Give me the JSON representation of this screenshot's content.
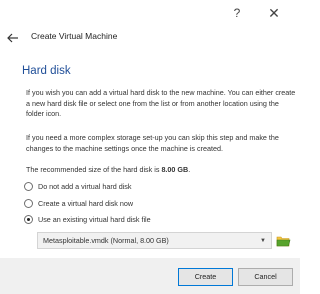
{
  "titlebar": {
    "help_label": "?",
    "close_label": "✕"
  },
  "header": {
    "back_icon": "arrow-left-icon",
    "title": "Create Virtual Machine"
  },
  "page": {
    "heading": "Hard disk",
    "paragraph1": "If you wish you can add a virtual hard disk to the new machine. You can either create a new hard disk file or select one from the list or from another location using the folder icon.",
    "paragraph2": "If you need a more complex storage set-up you can skip this step and make the changes to the machine settings once the machine is created.",
    "recommended_prefix": "The recommended size of the hard disk is ",
    "recommended_size": "8.00 GB",
    "recommended_suffix": "."
  },
  "options": [
    {
      "label": "Do not add a virtual hard disk",
      "selected": false
    },
    {
      "label": "Create a virtual hard disk now",
      "selected": false
    },
    {
      "label": "Use an existing virtual hard disk file",
      "selected": true
    }
  ],
  "file_select": {
    "value": "Metasploitable.vmdk (Normal, 8.00 GB)",
    "chevron": "▼",
    "folder_icon": "folder-icon"
  },
  "footer": {
    "create_label": "Create",
    "cancel_label": "Cancel"
  },
  "colors": {
    "heading": "#1f4e98",
    "default_button_border": "#0078d7",
    "folder_green": "#58a42c",
    "folder_yellow": "#f5c542"
  }
}
